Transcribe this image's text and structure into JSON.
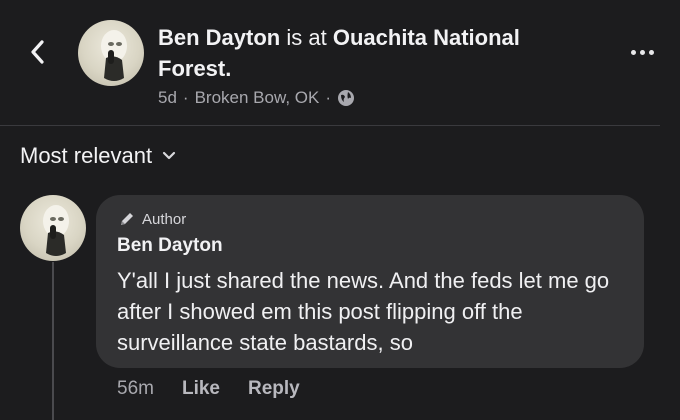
{
  "header": {
    "actor": "Ben Dayton",
    "connector": "is at",
    "place_line1": "Ouachita National",
    "place_line2": "Forest.",
    "time_ago": "5d",
    "separator": "·",
    "location": "Broken Bow, OK",
    "privacy_icon": "globe-icon",
    "back_icon": "chevron-left-icon",
    "more_icon": "ellipsis-icon"
  },
  "sort": {
    "label": "Most relevant",
    "icon": "chevron-down-icon"
  },
  "comment": {
    "badge_icon": "pencil-icon",
    "badge_label": "Author",
    "name": "Ben Dayton",
    "text": "Y'all I just shared the news.  And the feds let me go after I showed em this post flipping off the surveillance state bastards, so",
    "time": "56m",
    "like_label": "Like",
    "reply_label": "Reply"
  },
  "colors": {
    "background": "#1c1c1e",
    "bubble": "#333335",
    "muted_text": "#a8a8ae",
    "primary_text": "#f2f2f4"
  }
}
